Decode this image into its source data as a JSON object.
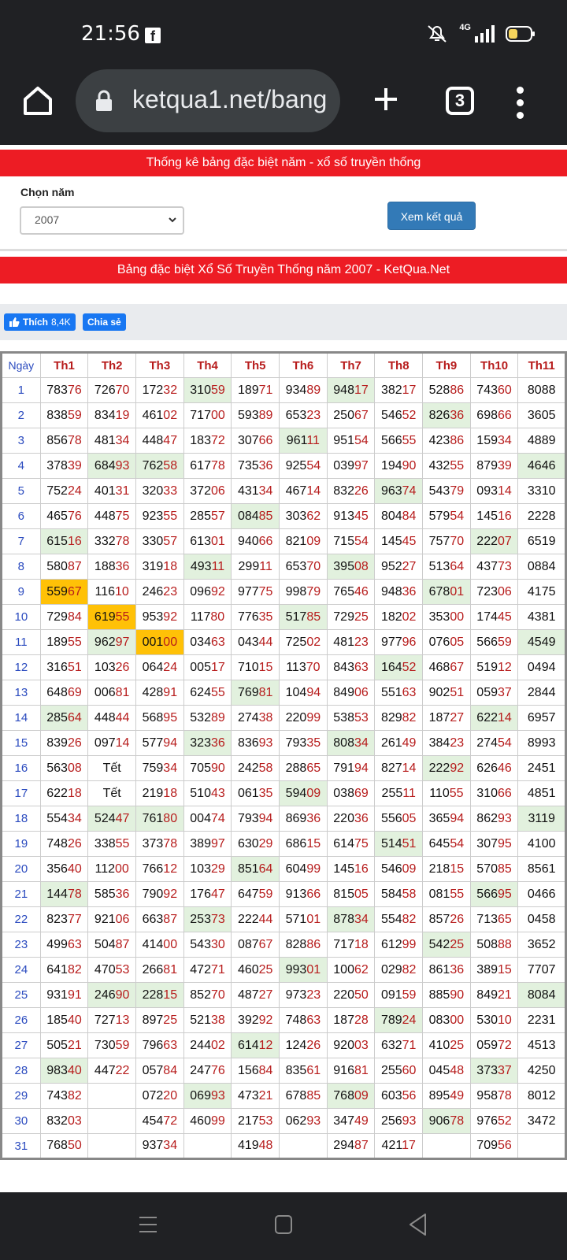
{
  "status_bar": {
    "time": "21:56",
    "app_icon": "facebook-icon",
    "network": "4G"
  },
  "browser": {
    "url": "ketqua1.net/bang",
    "tab_count": "3"
  },
  "page": {
    "header": "Thống kê bảng đặc biệt năm - xổ số truyền thống",
    "year_label": "Chọn năm",
    "year_value": "2007",
    "submit": "Xem kết quả",
    "table_title": "Bảng đặc biệt Xổ Số Truyền Thống năm 2007 - KetQua.Net",
    "like_label": "Thích",
    "like_count": "8,4K",
    "share_label": "Chia sẻ"
  },
  "table": {
    "columns": [
      "Ngày",
      "Th1",
      "Th2",
      "Th3",
      "Th4",
      "Th5",
      "Th6",
      "Th7",
      "Th8",
      "Th9",
      "Th10",
      "Th11"
    ],
    "rows": [
      [
        "1",
        "78376",
        "72670",
        "17232",
        "31059",
        "18971",
        "93489",
        "94817",
        "38217",
        "52886",
        "74360",
        "8088"
      ],
      [
        "2",
        "83859",
        "83419",
        "46102",
        "71700",
        "59389",
        "65323",
        "25067",
        "54652",
        "82636",
        "69866",
        "3605"
      ],
      [
        "3",
        "85678",
        "48134",
        "44847",
        "18372",
        "30766",
        "96111",
        "95154",
        "56655",
        "42386",
        "15934",
        "4889"
      ],
      [
        "4",
        "37839",
        "68493",
        "76258",
        "61778",
        "73536",
        "92554",
        "03997",
        "19490",
        "43255",
        "87939",
        "4646"
      ],
      [
        "5",
        "75224",
        "40131",
        "32033",
        "37206",
        "43134",
        "46714",
        "83226",
        "96374",
        "54379",
        "09314",
        "3310"
      ],
      [
        "6",
        "46576",
        "44875",
        "92355",
        "28557",
        "08485",
        "30362",
        "91345",
        "80484",
        "57954",
        "14516",
        "2228"
      ],
      [
        "7",
        "61516",
        "33278",
        "33057",
        "61301",
        "94066",
        "82109",
        "71554",
        "14545",
        "75770",
        "22207",
        "6519"
      ],
      [
        "8",
        "58087",
        "18836",
        "31918",
        "49311",
        "29911",
        "65370",
        "39508",
        "95227",
        "51364",
        "43773",
        "0884"
      ],
      [
        "9",
        "55967",
        "11610",
        "24623",
        "09692",
        "97775",
        "99879",
        "76546",
        "94836",
        "67801",
        "72306",
        "4175"
      ],
      [
        "10",
        "72984",
        "61955",
        "95392",
        "11780",
        "77635",
        "51785",
        "72925",
        "18202",
        "35300",
        "17445",
        "4381"
      ],
      [
        "11",
        "18955",
        "96297",
        "00100",
        "03463",
        "04344",
        "72502",
        "48123",
        "97796",
        "07605",
        "56659",
        "4549"
      ],
      [
        "12",
        "31651",
        "10326",
        "06424",
        "00517",
        "71015",
        "11370",
        "84363",
        "16452",
        "46867",
        "51912",
        "0494"
      ],
      [
        "13",
        "64869",
        "00681",
        "42891",
        "62455",
        "76981",
        "10494",
        "84906",
        "55163",
        "90251",
        "05937",
        "2844"
      ],
      [
        "14",
        "28564",
        "44844",
        "56895",
        "53289",
        "27438",
        "22099",
        "53853",
        "82982",
        "18727",
        "62214",
        "6957"
      ],
      [
        "15",
        "83926",
        "09714",
        "57794",
        "32336",
        "83693",
        "79335",
        "80834",
        "26149",
        "38423",
        "27454",
        "8993"
      ],
      [
        "16",
        "56308",
        "Tết",
        "75934",
        "70590",
        "24258",
        "28865",
        "79194",
        "82714",
        "22292",
        "62646",
        "2451"
      ],
      [
        "17",
        "62218",
        "Tết",
        "21918",
        "51043",
        "06135",
        "59409",
        "03869",
        "25511",
        "11055",
        "31066",
        "4851"
      ],
      [
        "18",
        "55434",
        "52447",
        "76180",
        "00474",
        "79394",
        "86936",
        "22036",
        "55605",
        "36594",
        "86293",
        "3119"
      ],
      [
        "19",
        "74826",
        "33855",
        "37378",
        "38997",
        "63029",
        "68615",
        "61475",
        "51451",
        "64554",
        "30795",
        "4100"
      ],
      [
        "20",
        "35640",
        "11200",
        "76612",
        "10329",
        "85164",
        "60499",
        "14516",
        "54609",
        "21815",
        "57085",
        "8561"
      ],
      [
        "21",
        "14478",
        "58536",
        "79092",
        "17647",
        "64759",
        "91366",
        "81505",
        "58458",
        "08155",
        "56695",
        "0466"
      ],
      [
        "22",
        "82377",
        "92106",
        "66387",
        "25373",
        "22244",
        "57101",
        "87834",
        "55482",
        "85726",
        "71365",
        "0458"
      ],
      [
        "23",
        "49963",
        "50487",
        "41400",
        "54330",
        "08767",
        "82886",
        "71718",
        "61299",
        "54225",
        "50888",
        "3652"
      ],
      [
        "24",
        "64182",
        "47053",
        "26681",
        "47271",
        "46025",
        "99301",
        "10062",
        "02982",
        "86136",
        "38915",
        "7707"
      ],
      [
        "25",
        "93191",
        "24690",
        "22815",
        "85270",
        "48727",
        "97323",
        "22050",
        "09159",
        "88590",
        "84921",
        "8084"
      ],
      [
        "26",
        "18540",
        "72713",
        "89725",
        "52138",
        "39292",
        "74863",
        "18728",
        "78924",
        "08300",
        "53010",
        "2231"
      ],
      [
        "27",
        "50521",
        "73059",
        "79663",
        "24402",
        "61412",
        "12426",
        "92003",
        "63271",
        "41025",
        "05972",
        "4513"
      ],
      [
        "28",
        "98340",
        "44722",
        "05784",
        "24776",
        "15684",
        "83561",
        "91681",
        "25560",
        "04548",
        "37337",
        "4250"
      ],
      [
        "29",
        "74382",
        "",
        "07220",
        "06993",
        "47321",
        "67885",
        "76809",
        "60356",
        "89549",
        "95878",
        "8012"
      ],
      [
        "30",
        "83203",
        "",
        "45472",
        "46099",
        "21753",
        "06293",
        "34749",
        "25693",
        "90678",
        "97652",
        "3472"
      ],
      [
        "31",
        "76850",
        "",
        "93734",
        "",
        "41948",
        "",
        "29487",
        "42117",
        "",
        "70956",
        ""
      ]
    ],
    "green": [
      [
        1,
        4
      ],
      [
        1,
        7
      ],
      [
        2,
        9
      ],
      [
        3,
        6
      ],
      [
        4,
        2
      ],
      [
        4,
        3
      ],
      [
        4,
        11
      ],
      [
        5,
        8
      ],
      [
        6,
        5
      ],
      [
        7,
        1
      ],
      [
        7,
        10
      ],
      [
        8,
        4
      ],
      [
        8,
        7
      ],
      [
        9,
        9
      ],
      [
        10,
        6
      ],
      [
        11,
        2
      ],
      [
        11,
        11
      ],
      [
        12,
        8
      ],
      [
        13,
        5
      ],
      [
        14,
        1
      ],
      [
        14,
        10
      ],
      [
        15,
        4
      ],
      [
        15,
        7
      ],
      [
        16,
        9
      ],
      [
        17,
        6
      ],
      [
        18,
        2
      ],
      [
        18,
        3
      ],
      [
        18,
        11
      ],
      [
        19,
        8
      ],
      [
        20,
        5
      ],
      [
        21,
        1
      ],
      [
        21,
        10
      ],
      [
        22,
        4
      ],
      [
        22,
        7
      ],
      [
        23,
        9
      ],
      [
        24,
        6
      ],
      [
        25,
        2
      ],
      [
        25,
        3
      ],
      [
        25,
        11
      ],
      [
        26,
        8
      ],
      [
        27,
        5
      ],
      [
        28,
        1
      ],
      [
        28,
        10
      ],
      [
        29,
        4
      ],
      [
        29,
        7
      ],
      [
        30,
        9
      ]
    ],
    "orange": [
      [
        9,
        1
      ],
      [
        10,
        2
      ],
      [
        11,
        3
      ]
    ],
    "highlight_colors": {
      "green": "#e2f1de",
      "orange": "#ffc107",
      "accent_red": "#ed1c24",
      "button_blue": "#337ab7"
    }
  },
  "nav": {
    "icons": [
      "recent-apps-icon",
      "home-icon",
      "back-icon"
    ]
  }
}
